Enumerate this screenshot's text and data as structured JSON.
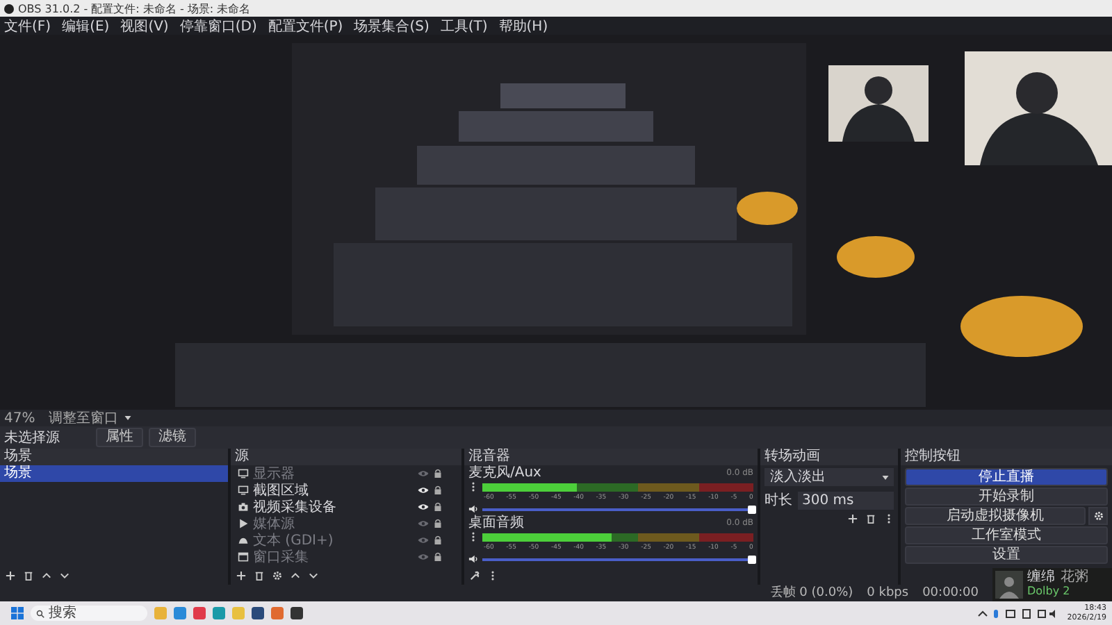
{
  "window": {
    "title": "OBS 31.0.2 - 配置文件: 未命名 - 场景: 未命名"
  },
  "menu": [
    "文件(F)",
    "编辑(E)",
    "视图(V)",
    "停靠窗口(D)",
    "配置文件(P)",
    "场景集合(S)",
    "工具(T)",
    "帮助(H)"
  ],
  "zoom_bar": {
    "zoom": "47%",
    "mode": "调整至窗口"
  },
  "source_toolbar": {
    "status": "未选择源",
    "buttons": [
      "属性",
      "滤镜"
    ]
  },
  "scenes": {
    "title": "场景",
    "items": [
      {
        "label": "场景",
        "selected": true
      }
    ]
  },
  "sources": {
    "title": "源",
    "items": [
      {
        "label": "显示器",
        "kind": "monitor",
        "visible": false
      },
      {
        "label": "截图区域",
        "kind": "monitor",
        "visible": true
      },
      {
        "label": "视频采集设备",
        "kind": "camera",
        "visible": true
      },
      {
        "label": "媒体源",
        "kind": "media",
        "visible": false
      },
      {
        "label": "文本 (GDI+)",
        "kind": "text",
        "visible": false
      },
      {
        "label": "窗口采集",
        "kind": "window",
        "visible": false
      }
    ]
  },
  "mixer": {
    "title": "混音器",
    "channels": [
      {
        "name": "麦克风/Aux",
        "reading": "0.0 dB",
        "meter": {
          "level": 0.36
        },
        "ticks": [
          "-60",
          "-55",
          "-50",
          "-45",
          "-40",
          "-35",
          "-30",
          "-25",
          "-20",
          "-15",
          "-10",
          "-5",
          "0"
        ],
        "volume": {
          "level": 1
        }
      },
      {
        "name": "桌面音频",
        "reading": "0.0 dB",
        "meter": {
          "level": 0.47
        },
        "ticks": [
          "-60",
          "-55",
          "-50",
          "-45",
          "-40",
          "-35",
          "-30",
          "-25",
          "-20",
          "-15",
          "-10",
          "-5",
          "0"
        ],
        "volume": {
          "level": 1
        }
      }
    ]
  },
  "transitions": {
    "title": "转场动画",
    "type": "淡入淡出",
    "duration_label": "时长",
    "duration": "300 ms"
  },
  "controls": {
    "title": "控制按钮",
    "buttons": [
      {
        "label": "停止直播",
        "active": true,
        "has_settings": false
      },
      {
        "label": "开始录制",
        "active": false,
        "has_settings": false
      },
      {
        "label": "启动虚拟摄像机",
        "active": false,
        "has_settings": true
      },
      {
        "label": "工作室模式",
        "active": false,
        "has_settings": false
      },
      {
        "label": "设置",
        "active": false,
        "has_settings": false
      }
    ]
  },
  "status_bar": {
    "dropped": "丢帧 0 (0.0%)",
    "bitrate": "0 kbps",
    "time": "00:00:00"
  },
  "notification": {
    "title": "缠绵",
    "artist": "花粥",
    "app": "Dolby 2"
  },
  "taskbar": {
    "search": "搜索",
    "time": "18:43",
    "date": "2026/2/19"
  }
}
